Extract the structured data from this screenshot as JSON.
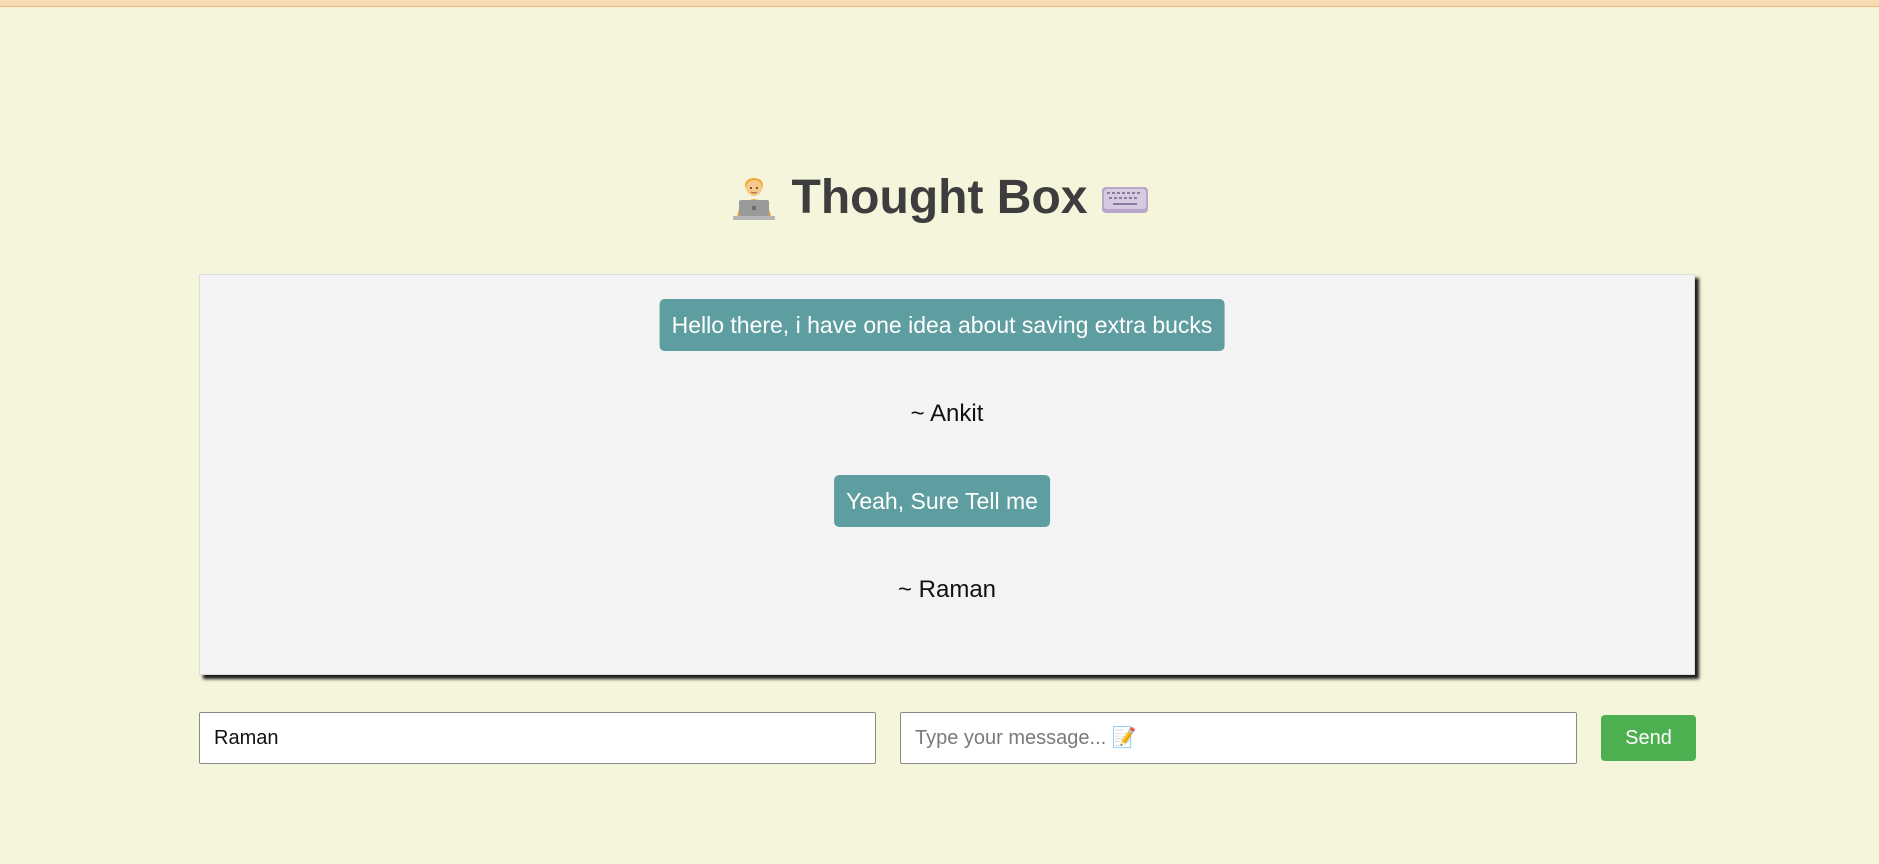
{
  "header": {
    "title": "Thought Box",
    "left_icon": "person-at-laptop-icon",
    "right_icon": "keyboard-icon"
  },
  "messages": [
    {
      "text": "Hello there, i have one idea about saving extra bucks",
      "author": "~ Ankit"
    },
    {
      "text": "Yeah, Sure Tell me",
      "author": "~ Raman"
    }
  ],
  "form": {
    "name_value": "Raman",
    "message_placeholder": "Type your message... 📝",
    "send_label": "Send"
  },
  "colors": {
    "background": "#f5f5dc",
    "bubble": "#5f9ea0",
    "send_button": "#4caf50",
    "title": "#3d3d3d"
  }
}
